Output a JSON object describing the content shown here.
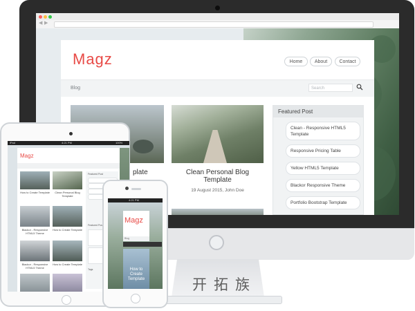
{
  "desktop": {
    "logo": "Magz",
    "nav": [
      {
        "label": "Home"
      },
      {
        "label": "About"
      },
      {
        "label": "Contact"
      }
    ],
    "breadcrumb": "Blog",
    "search_placeholder": "Search",
    "post_fragment": "plate",
    "featured_post": {
      "title": "Clean Personal Blog Template",
      "meta": "19 August 2015, John Doe"
    },
    "sidebar": {
      "heading": "Featured Post",
      "items": [
        "Clean - Responsive HTML5 Template",
        "Responsive Pricing Table",
        "Yellow HTML5 Template",
        "Blackor Responsive Theme",
        "Portfolio Bootstrap Template"
      ]
    }
  },
  "tablet": {
    "status_left": "iPad",
    "status_time": "4:21 PM",
    "status_right": "100%",
    "logo": "Magz",
    "posts": [
      {
        "title": "How to Create Template"
      },
      {
        "title": "Clean Personal Blog Template"
      },
      {
        "title": "Blackor - Responsive HTML5 Theme"
      },
      {
        "title": "How to Create Template"
      },
      {
        "title": "Blackor - Responsive HTML5 Theme"
      },
      {
        "title": "How to Create Template"
      }
    ],
    "sidebar_heading": "Featured Post",
    "sidebar_heading_2": "Featured Post",
    "tags_heading": "Tags"
  },
  "phone": {
    "status_time": "4:21 PM",
    "logo": "Magz",
    "breadcrumb": "Blog",
    "post_title": "How to Create Template"
  },
  "watermark": "开拓族"
}
